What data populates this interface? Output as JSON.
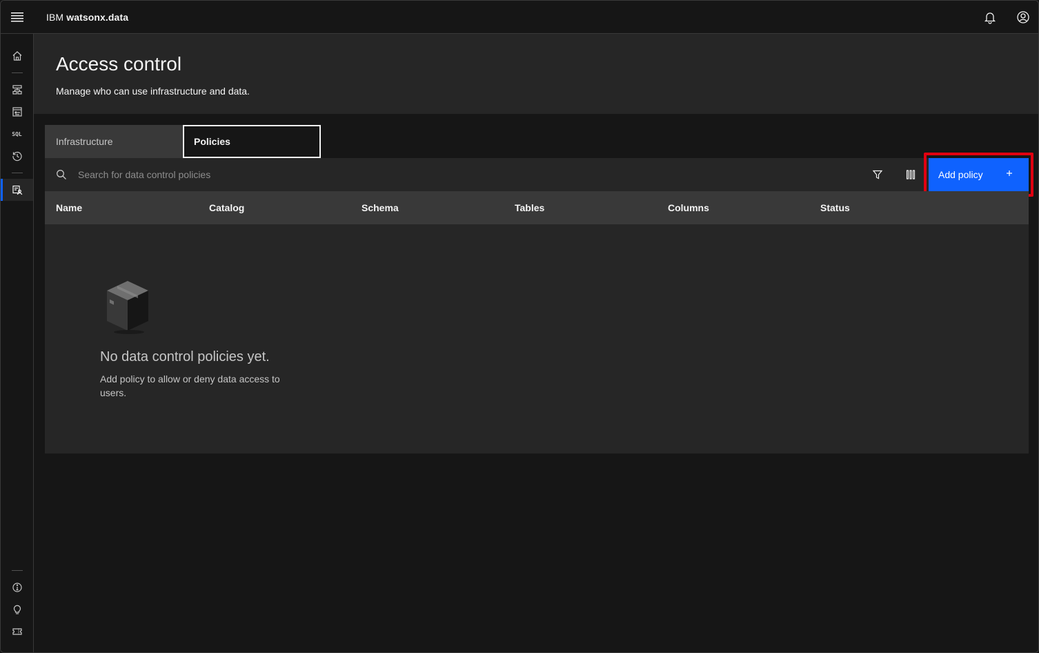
{
  "header": {
    "brand_prefix": "IBM",
    "brand_name": "watsonx.data",
    "icons": [
      "menu-icon",
      "notification-icon",
      "user-profile-icon"
    ]
  },
  "rail": {
    "items": [
      {
        "name": "home",
        "icon": "home-icon"
      },
      {
        "name": "infrastructure-manager",
        "icon": "infrastructure-icon"
      },
      {
        "name": "data-manager",
        "icon": "data-manager-icon"
      },
      {
        "name": "sql",
        "icon": "sql-icon",
        "label": "SQL"
      },
      {
        "name": "query-history",
        "icon": "history-icon"
      },
      {
        "name": "access-control",
        "icon": "access-control-icon",
        "active": true
      }
    ],
    "bottom_items": [
      {
        "name": "about",
        "icon": "info-icon"
      },
      {
        "name": "tips",
        "icon": "lightbulb-icon"
      },
      {
        "name": "license",
        "icon": "ticket-icon"
      }
    ]
  },
  "page": {
    "title": "Access control",
    "subtitle": "Manage who can use infrastructure and data."
  },
  "tabs": [
    {
      "label": "Infrastructure",
      "selected": false
    },
    {
      "label": "Policies",
      "selected": true
    }
  ],
  "toolbar": {
    "search_placeholder": "Search for data control policies",
    "add_label": "Add policy"
  },
  "table": {
    "columns": [
      "Name",
      "Catalog",
      "Schema",
      "Tables",
      "Columns",
      "Status"
    ]
  },
  "empty_state": {
    "title": "No data control policies yet.",
    "description": "Add policy to allow or deny data access to users."
  },
  "colors": {
    "accent": "#0f62fe",
    "highlight": "#e00010",
    "background": "#161616",
    "layer": "#262626"
  }
}
